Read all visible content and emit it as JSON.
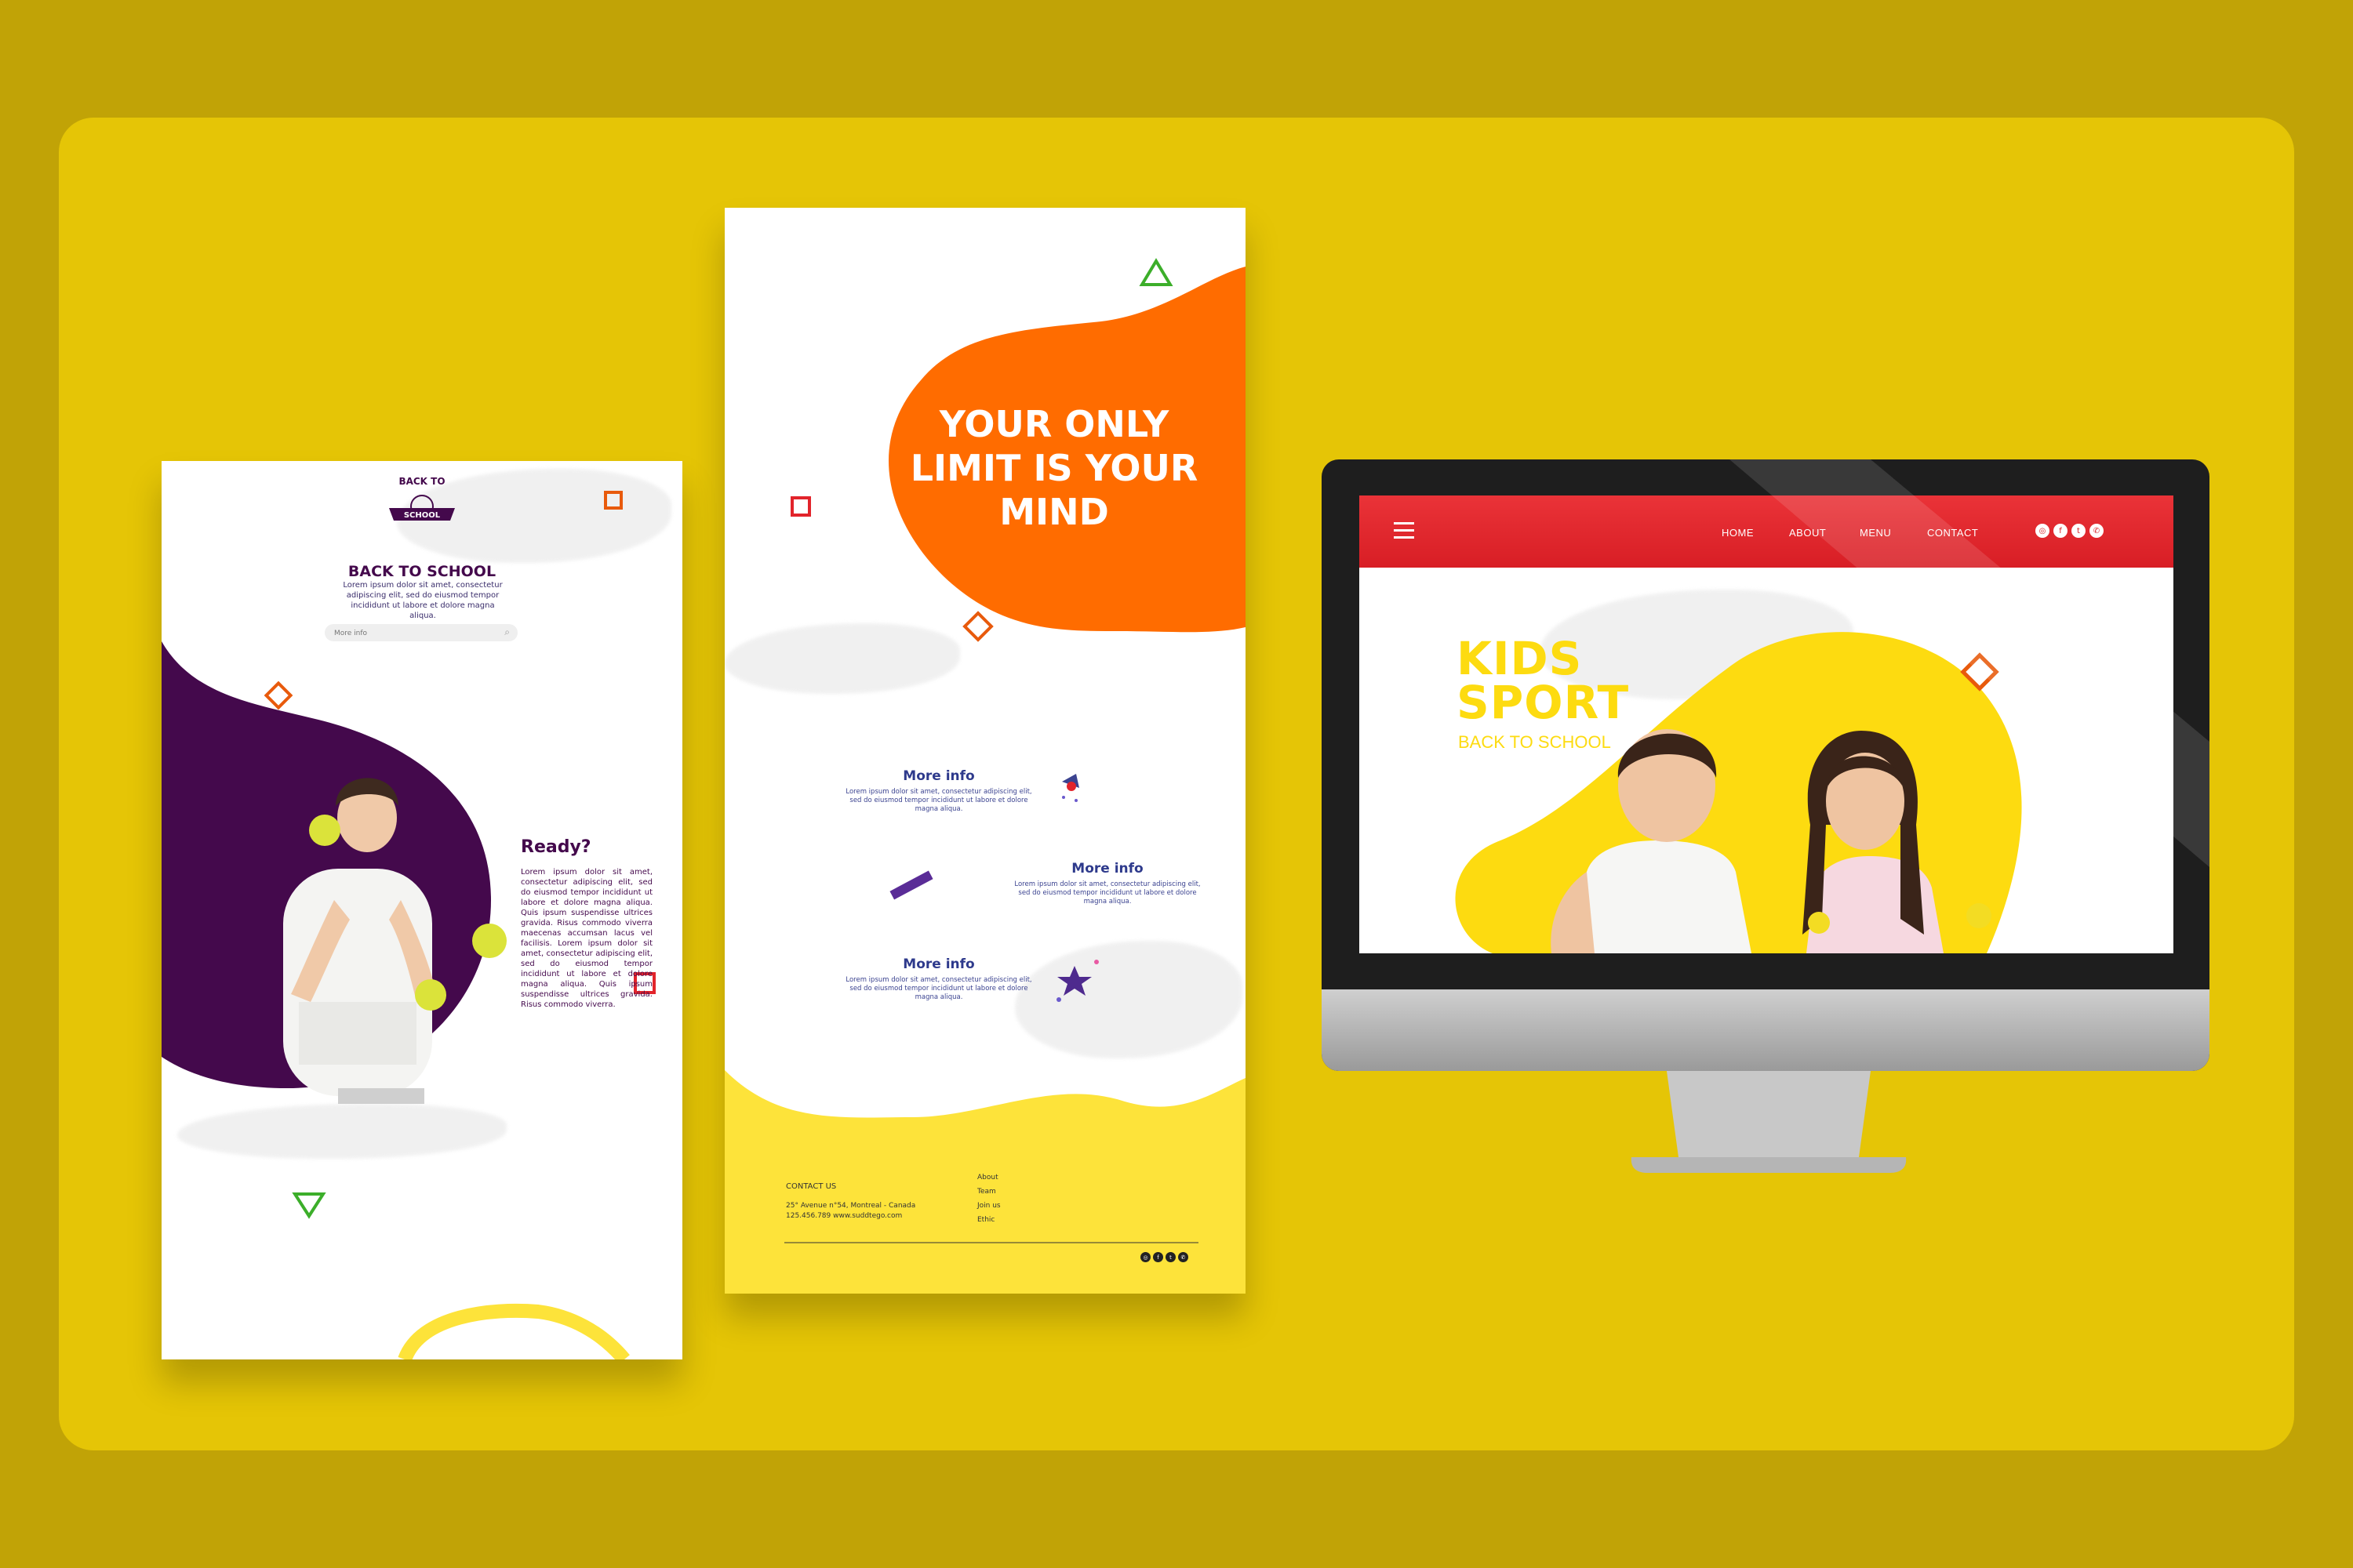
{
  "mobile_card": {
    "logo_text": "BACK TO SCHOOL",
    "title": "BACK TO SCHOOL",
    "intro": "Lorem ipsum dolor sit amet, consectetur adipiscing elit, sed do eiusmod tempor incididunt ut labore et dolore magna aliqua.",
    "search_placeholder": "More info",
    "ready_title": "Ready?",
    "ready_body": "Lorem ipsum dolor sit amet, consectetur adipiscing elit, sed do eiusmod tempor incididunt ut labore et dolore magna aliqua. Quis ipsum suspendisse ultrices gravida. Risus commodo viverra maecenas accumsan lacus vel facilisis. Lorem ipsum dolor sit amet, consectetur adipiscing elit, sed do eiusmod tempor incididunt ut labore et dolore magna aliqua. Quis ipsum suspendisse ultrices gravida. Risus commodo viverra."
  },
  "tall_card": {
    "headline": [
      "YOUR ONLY",
      "LIMIT IS YOUR",
      "MIND"
    ],
    "features": [
      {
        "title": "More info",
        "body": "Lorem ipsum dolor sit amet, consectetur adipiscing elit, sed do eiusmod tempor incididunt ut labore et dolore magna aliqua.",
        "icon": "rocket-icon"
      },
      {
        "title": "More info",
        "body": "Lorem ipsum dolor sit amet, consectetur adipiscing elit, sed do eiusmod tempor incididunt ut labore et dolore magna aliqua.",
        "icon": "ruler-icon"
      },
      {
        "title": "More info",
        "body": "Lorem ipsum dolor sit amet, consectetur adipiscing elit, sed do eiusmod tempor incididunt ut labore et dolore magna aliqua.",
        "icon": "star-icon"
      }
    ],
    "footer": {
      "contact_heading": "CONTACT US",
      "address": "25° Avenue n°54, Montreal - Canada",
      "phone_web": "125.456.789  www.suddtego.com",
      "links": [
        "About",
        "Team",
        "Join us",
        "Ethic"
      ],
      "social": [
        "instagram-icon",
        "facebook-icon",
        "twitter-icon",
        "whatsapp-icon"
      ]
    }
  },
  "desktop": {
    "nav": [
      "HOME",
      "ABOUT",
      "MENU",
      "CONTACT"
    ],
    "hero_line1": "KIDS",
    "hero_line2": "SPORT",
    "hero_sub": "BACK TO SCHOOL",
    "social": [
      "instagram-icon",
      "facebook-icon",
      "twitter-icon",
      "whatsapp-icon"
    ]
  },
  "colors": {
    "page_bg": "#c1a306",
    "board": "#e5c506",
    "purple": "#44094c",
    "orange": "#ff6c00",
    "yellow": "#fde33a",
    "red": "#e2242b",
    "green": "#3cae2a"
  }
}
